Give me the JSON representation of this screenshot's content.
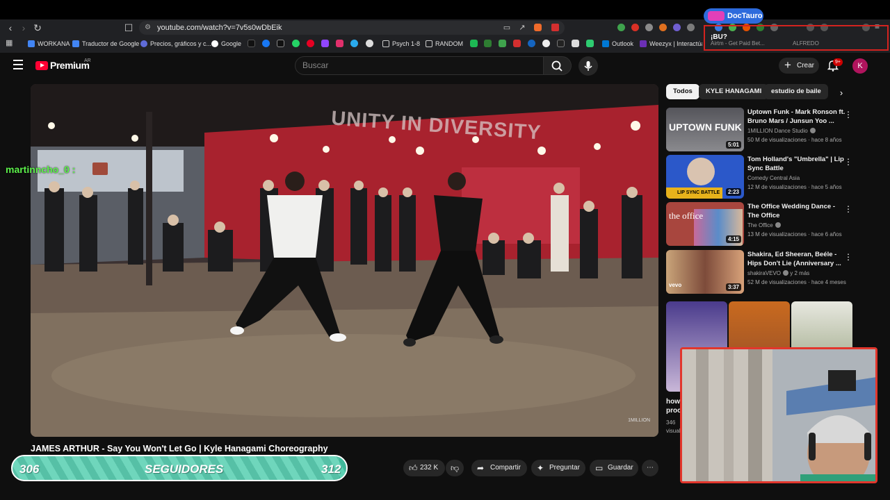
{
  "browser": {
    "url": "youtube.com/watch?v=7v5s0wDbEik",
    "bookmarks": [
      {
        "label": "WORKANA",
        "color": "#4285f4"
      },
      {
        "label": "Traductor de Google",
        "color": "#4285f4"
      },
      {
        "label": "Precios, gráficos y c...",
        "color": "#5f6bd8"
      },
      {
        "label": "Google",
        "color": "#ea4335"
      },
      {
        "label": "Psych 1-8",
        "color": "#888888"
      },
      {
        "label": "RANDOM",
        "color": "#888888"
      },
      {
        "label": "Outlook",
        "color": "#0078d4"
      },
      {
        "label": "Weezyx | Interactúa...",
        "color": "#6b2fb5"
      },
      {
        "label": "Airtm - Get Paid Bet...",
        "color": "#888888"
      },
      {
        "label": "ALFREDO",
        "color": "#888888"
      }
    ],
    "overlay_question": "¡BU?"
  },
  "stream_overlay": {
    "doctauro_label": "DocTauro",
    "chat_user": "martinncho_0 :",
    "follower_current": "306",
    "follower_label": "SEGUIDORES",
    "follower_goal": "312",
    "follower_progress": 0.98
  },
  "youtube": {
    "brand": "Premium",
    "region": "AR",
    "search_placeholder": "Buscar",
    "create_label": "Crear",
    "notif_badge": "9+",
    "avatar_letter": "K"
  },
  "video": {
    "banner_text": "UNITY IN DIVERSITY",
    "watermark": "1MILLION",
    "title": "JAMES ARTHUR - Say You Won't Let Go | Kyle Hanagami Choreography",
    "likes": "232 K",
    "share_label": "Compartir",
    "ask_label": "Preguntar",
    "save_label": "Guardar"
  },
  "chips": [
    "Todos",
    "KYLE HANAGAMI",
    "estudio de baile"
  ],
  "recommendations": [
    {
      "title": "Uptown Funk - Mark Ronson ft. Bruno Mars / Junsun Yoo ...",
      "channel": "1MILLION Dance Studio",
      "meta": "50 M de visualizaciones · hace 8 años",
      "duration": "5:01",
      "thumb_text": "UPTOWN FUNK",
      "thumb_color": "#6c6c72"
    },
    {
      "title": "Tom Holland's \"Umbrella\" | Lip Sync Battle",
      "channel": "Comedy Central Asia",
      "meta": "12 M de visualizaciones · hace 5 años",
      "duration": "2:23",
      "thumb_text": "LIP SYNC BATTLE",
      "thumb_color": "#2b58c9"
    },
    {
      "title": "The Office Wedding Dance - The Office",
      "channel": "The Office",
      "meta": "13 M de visualizaciones · hace 6 años",
      "duration": "4:15",
      "thumb_text": "the office",
      "thumb_color": "#a8463e"
    },
    {
      "title": "Shakira, Ed Sheeran, Beéle - Hips Don't Lie (Anniversary ...",
      "channel": "shakiraVEVO",
      "channel_extra": "y 2 más",
      "meta": "52 M de visualizaciones · hace 4 meses",
      "duration": "3:37",
      "thumb_text": "vevo",
      "thumb_color": "#b55c3a"
    }
  ],
  "shorts": {
    "caption": "how proc",
    "meta": "346 visual"
  }
}
